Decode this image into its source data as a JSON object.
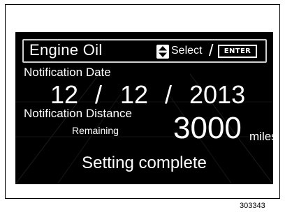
{
  "display": {
    "menu_title": "Engine Oil",
    "select_icon": "up-down-arrow-icon",
    "select_label": "Select",
    "separator": "/",
    "enter_key_label": "ENTER",
    "notification_date_label": "Notification Date",
    "date": {
      "month": "12",
      "separator": "/",
      "day": "12",
      "year": "2013"
    },
    "notification_distance_label": "Notification Distance",
    "remaining_label": "Remaining",
    "distance_value": "3000",
    "distance_unit": "miles",
    "status_text": "Setting complete"
  },
  "figure_id": "303343",
  "colors": {
    "screen_background": "#000000",
    "screen_text": "#ffffff",
    "page_background": "#ffffff"
  }
}
